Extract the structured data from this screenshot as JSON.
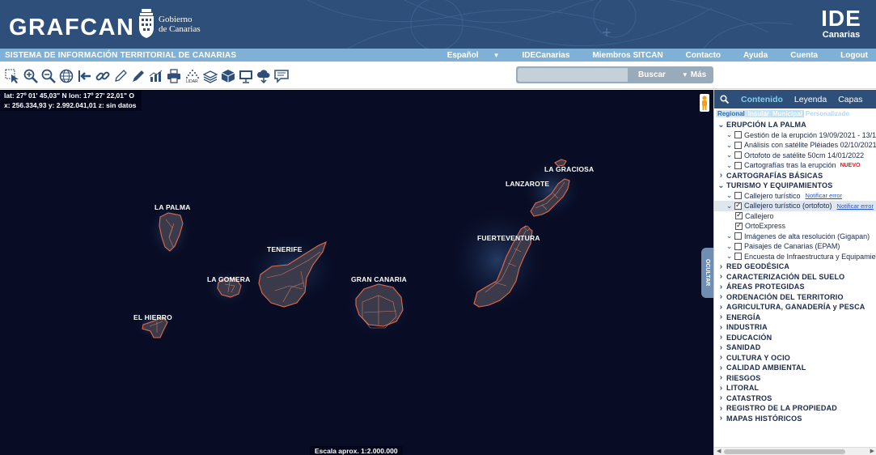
{
  "header": {
    "logo_text": "GRAFCAN",
    "gob_line1": "Gobierno",
    "gob_line2": "de Canarias",
    "ide_big": "IDE",
    "ide_small": "Canarias"
  },
  "menubar": {
    "title": "SISTEMA DE INFORMACIÓN TERRITORIAL DE CANARIAS",
    "language": "Español",
    "items": [
      "IDECanarias",
      "Miembros SITCAN",
      "Contacto",
      "Ayuda",
      "Cuenta",
      "Logout"
    ]
  },
  "toolbar": {
    "lidar_label": "LIDAR",
    "icons": [
      "select-icon",
      "zoom-in-icon",
      "zoom-out-icon",
      "globe-icon",
      "exit-icon",
      "link-icon",
      "pencil-icon",
      "measure-icon",
      "chart-icon",
      "print-icon",
      "lidar-icon",
      "layers-icon",
      "3d-box-icon",
      "presentation-icon",
      "cloud-download-icon",
      "comment-icon"
    ],
    "search_placeholder": "",
    "search_label": "Buscar",
    "more_label": "Más"
  },
  "map": {
    "coords_line1": "lat: 27º 01' 45,03\" N  lon: 17º 27' 22,01\" O",
    "coords_line2": "x: 256.334,93  y: 2.992.041,01  z: sin datos",
    "scale": "Escala aprox. 1:2.000.000",
    "hide_label": "OCULTAR",
    "islands": [
      "LA PALMA",
      "LA GOMERA",
      "TENERIFE",
      "EL HIERRO",
      "GRAN CANARIA",
      "FUERTEVENTURA",
      "LANZAROTE",
      "LA GRACIOSA"
    ]
  },
  "panel": {
    "tabs": [
      "Contenido",
      "Leyenda",
      "Capas"
    ],
    "subtabs": [
      "Regional",
      "Insular",
      "Municipal",
      "Personalizado"
    ],
    "tree": [
      {
        "label": "ERUPCIÓN LA PALMA",
        "level": 0,
        "type": "cat",
        "expanded": true
      },
      {
        "label": "Gestión de la erupción 19/09/2021 - 13/12/2021",
        "level": 1,
        "type": "item"
      },
      {
        "label": "Análisis con satélite Pléiades 02/10/2021",
        "level": 1,
        "type": "item"
      },
      {
        "label": "Ortofoto de satélite 50cm 14/01/2022",
        "level": 1,
        "type": "item"
      },
      {
        "label": "Cartografías tras la erupción",
        "level": 1,
        "type": "item",
        "badge": "NUEVO"
      },
      {
        "label": "CARTOGRAFÍAS BÁSICAS",
        "level": 0,
        "type": "cat"
      },
      {
        "label": "TURISMO Y EQUIPAMIENTOS",
        "level": 0,
        "type": "cat",
        "expanded": true
      },
      {
        "label": "Callejero turístico",
        "level": 1,
        "type": "item",
        "link": "Notificar error"
      },
      {
        "label": "Callejero turístico (ortofoto)",
        "level": 1,
        "type": "item",
        "checked": true,
        "selected": true,
        "link": "Notificar error",
        "expanded": true
      },
      {
        "label": "Callejero",
        "level": 2,
        "type": "leaf",
        "checked": true
      },
      {
        "label": "OrtoExpress",
        "level": 2,
        "type": "leaf",
        "checked": true
      },
      {
        "label": "Imágenes de alta resolución (Gigapan)",
        "level": 1,
        "type": "item"
      },
      {
        "label": "Paisajes de Canarias (EPAM)",
        "level": 1,
        "type": "item"
      },
      {
        "label": "Encuesta de Infraestructura y Equipamientos Locales",
        "level": 1,
        "type": "item"
      },
      {
        "label": "RED GEODÉSICA",
        "level": 0,
        "type": "cat"
      },
      {
        "label": "CARACTERIZACIÓN DEL SUELO",
        "level": 0,
        "type": "cat"
      },
      {
        "label": "ÁREAS PROTEGIDAS",
        "level": 0,
        "type": "cat"
      },
      {
        "label": "ORDENACIÓN DEL TERRITORIO",
        "level": 0,
        "type": "cat"
      },
      {
        "label": "AGRICULTURA, GANADERÍA y PESCA",
        "level": 0,
        "type": "cat"
      },
      {
        "label": "ENERGÍA",
        "level": 0,
        "type": "cat"
      },
      {
        "label": "INDUSTRIA",
        "level": 0,
        "type": "cat"
      },
      {
        "label": "EDUCACIÓN",
        "level": 0,
        "type": "cat"
      },
      {
        "label": "SANIDAD",
        "level": 0,
        "type": "cat"
      },
      {
        "label": "CULTURA Y OCIO",
        "level": 0,
        "type": "cat"
      },
      {
        "label": "CALIDAD AMBIENTAL",
        "level": 0,
        "type": "cat"
      },
      {
        "label": "RIESGOS",
        "level": 0,
        "type": "cat"
      },
      {
        "label": "LITORAL",
        "level": 0,
        "type": "cat"
      },
      {
        "label": "CATASTROS",
        "level": 0,
        "type": "cat"
      },
      {
        "label": "REGISTRO DE LA PROPIEDAD",
        "level": 0,
        "type": "cat"
      },
      {
        "label": "MAPAS HISTÓRICOS",
        "level": 0,
        "type": "cat"
      }
    ]
  },
  "colors": {
    "header_bg": "#2d4f79",
    "menubar_bg": "#7fb1d6",
    "map_bg": "#080c24",
    "island_stroke": "#e36a4a",
    "active_tab": "#7fd0ef",
    "nuevo": "#e41c1c"
  }
}
